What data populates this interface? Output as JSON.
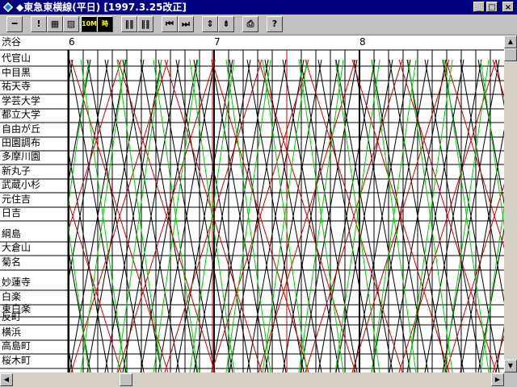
{
  "window": {
    "title": "◆東急東横線(平日) [1997.3.25改正]",
    "buttons": {
      "minimize": "_",
      "maximize": "□",
      "close": "×"
    }
  },
  "toolbar": {
    "buttons": [
      {
        "name": "view-mode-button",
        "label": "━"
      },
      {
        "name": "exclaim-button",
        "label": "!"
      },
      {
        "name": "grid-button",
        "label": "▦"
      },
      {
        "name": "diagonal-grid-button",
        "label": "▨"
      },
      {
        "name": "ten-min-button",
        "label": "10M"
      },
      {
        "name": "hours-button",
        "label": "時"
      },
      {
        "name": "vertical-lines-button",
        "label": "‖‖"
      },
      {
        "name": "vertical-lines-2-button",
        "label": "‖‖"
      },
      {
        "name": "first-button",
        "label": "⏮"
      },
      {
        "name": "last-button",
        "label": "⏭"
      },
      {
        "name": "expand-button",
        "label": "⇕"
      },
      {
        "name": "collapse-button",
        "label": "⇟"
      },
      {
        "name": "print-button",
        "label": "⎙"
      },
      {
        "name": "help-button",
        "label": "?"
      }
    ]
  },
  "diagram": {
    "header_station": "渋谷",
    "hours": [
      "6",
      "7",
      "8"
    ],
    "stations": [
      "代官山",
      "中目黒",
      "祐天寺",
      "学芸大学",
      "都立大学",
      "自由が丘",
      "田園調布",
      "多摩川園",
      "新丸子",
      "武蔵小杉",
      "元住吉",
      "日吉",
      "綱島",
      "大倉山",
      "菊名",
      "妙蓮寺",
      "白楽",
      "東白楽",
      "反町",
      "横浜",
      "高島町",
      "桜木町"
    ],
    "colors": {
      "normal": "#000000",
      "express": "#cc0000",
      "local": "#00cc00",
      "grid": "#000000"
    }
  }
}
